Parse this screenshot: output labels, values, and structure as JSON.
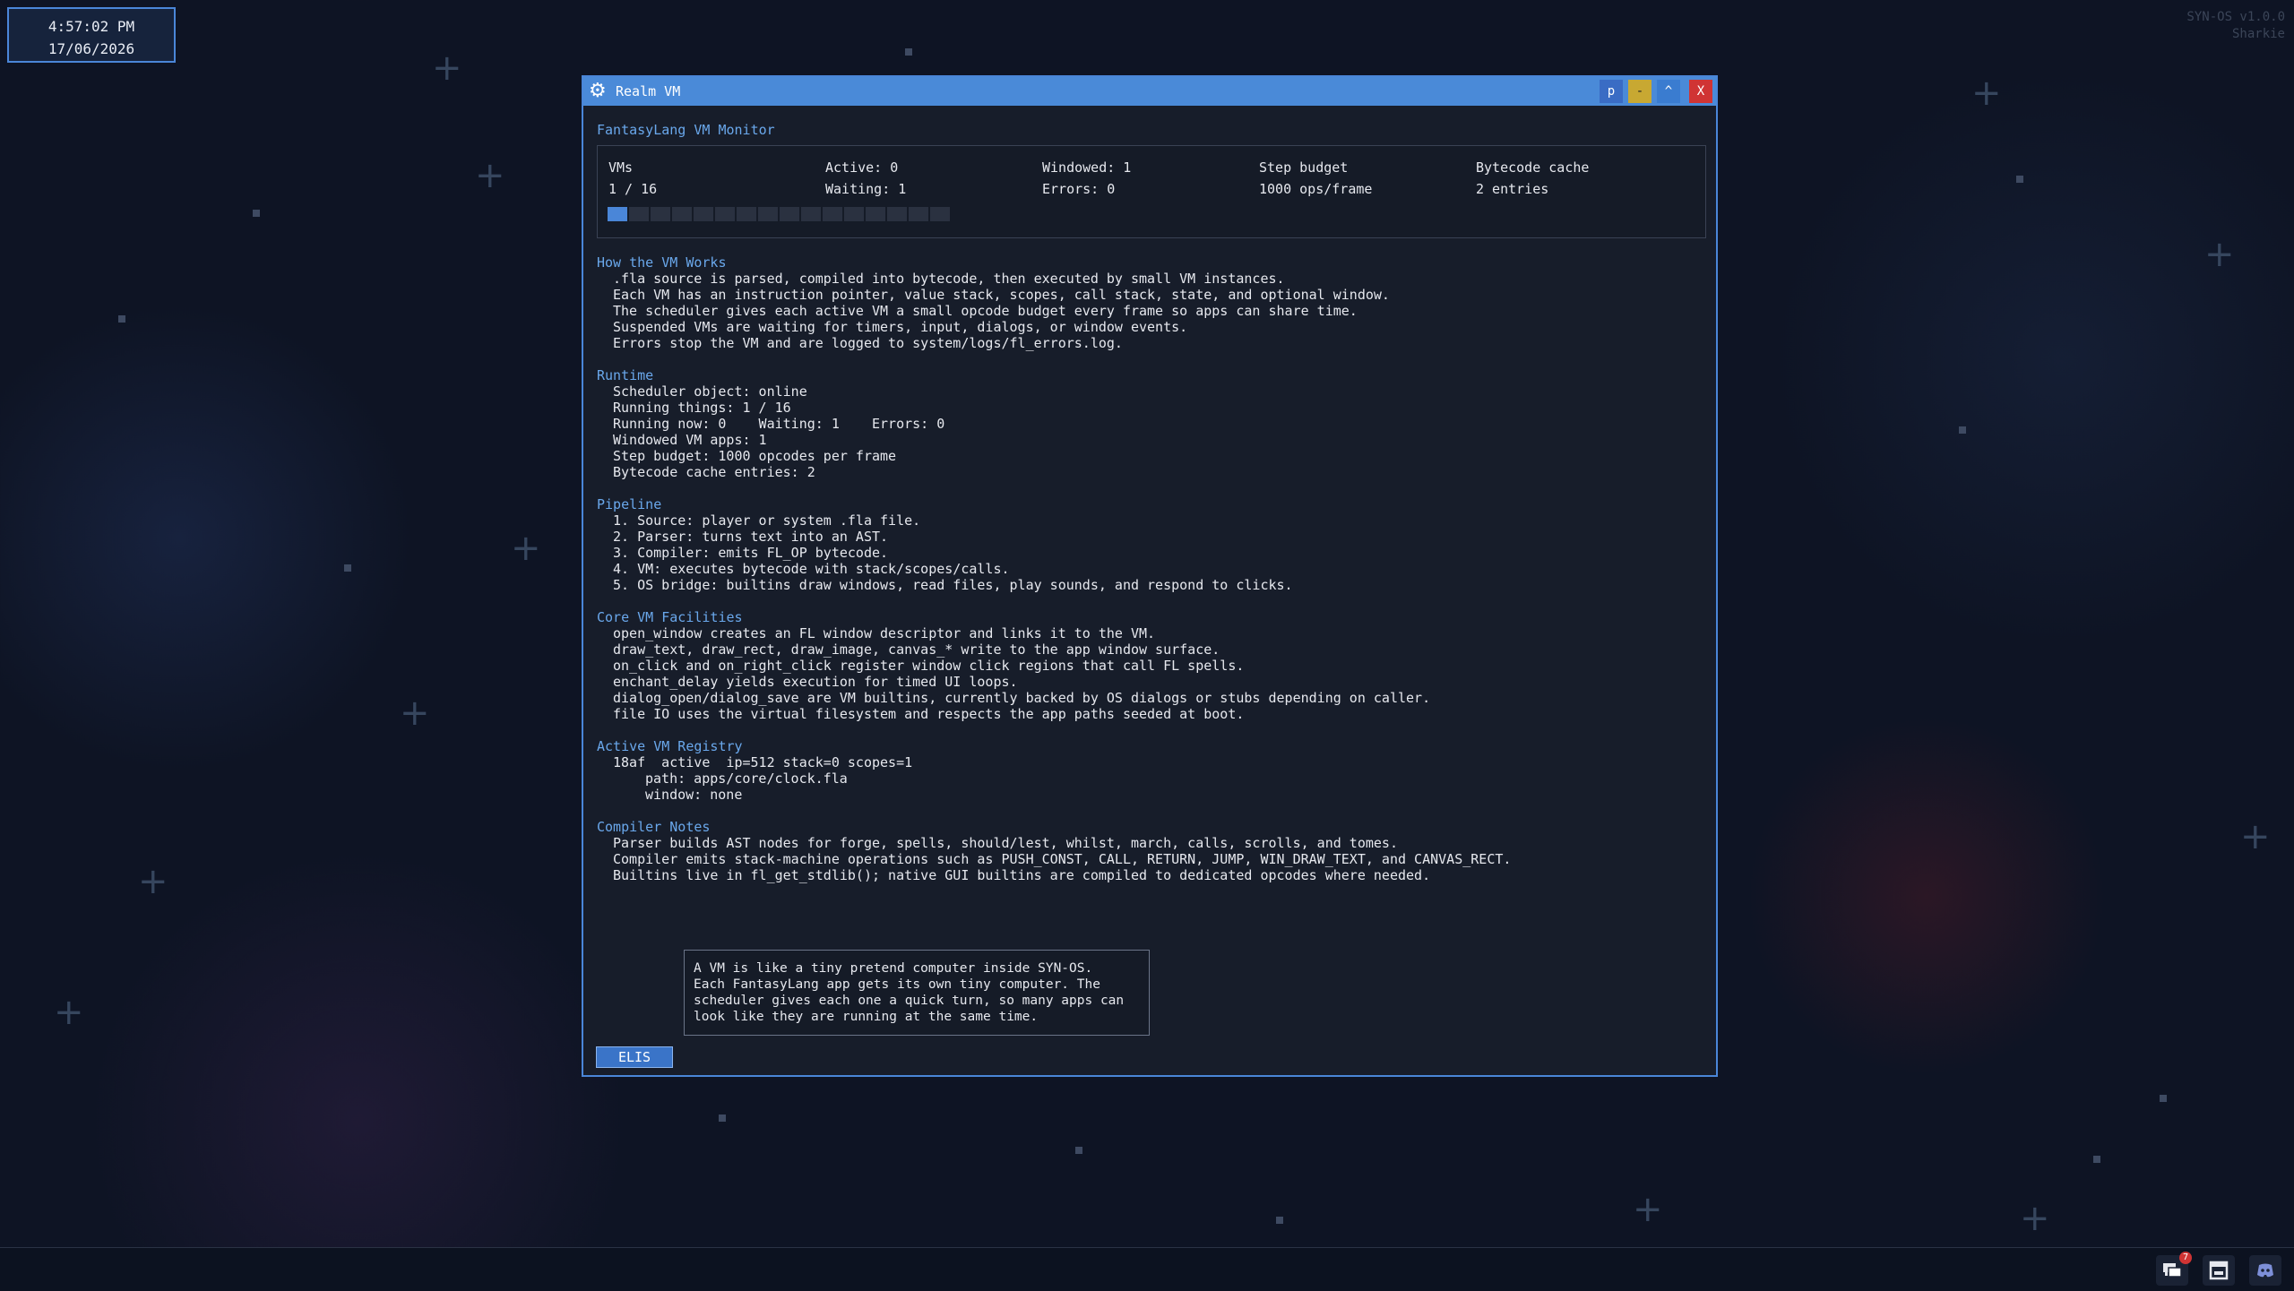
{
  "clock": {
    "time": "4:57:02 PM",
    "date": "17/06/2026"
  },
  "os": {
    "version": "SYN-OS v1.0.0",
    "user": "Sharkie"
  },
  "window": {
    "title": "Realm VM",
    "buttons": {
      "pin": "p",
      "minimize": "-",
      "maximize": "^",
      "close": "X"
    }
  },
  "monitor": {
    "title": "FantasyLang VM Monitor",
    "stats": {
      "vms_label": "VMs",
      "vms_value": "1 / 16",
      "active": "Active: 0",
      "waiting": "Waiting: 1",
      "windowed": "Windowed: 1",
      "errors": "Errors: 0",
      "budget_label": "Step budget",
      "budget_value": "1000 ops/frame",
      "cache_label": "Bytecode cache",
      "cache_value": "2 entries"
    },
    "slots_total": 16,
    "slots_used": 1
  },
  "sections": [
    {
      "title": "How the VM Works",
      "lines": [
        ".fla source is parsed, compiled into bytecode, then executed by small VM instances.",
        "Each VM has an instruction pointer, value stack, scopes, call stack, state, and optional window.",
        "The scheduler gives each active VM a small opcode budget every frame so apps can share time.",
        "Suspended VMs are waiting for timers, input, dialogs, or window events.",
        "Errors stop the VM and are logged to system/logs/fl_errors.log."
      ]
    },
    {
      "title": "Runtime",
      "lines": [
        "Scheduler object: online",
        "Running things: 1 / 16",
        "Running now: 0    Waiting: 1    Errors: 0",
        "Windowed VM apps: 1",
        "Step budget: 1000 opcodes per frame",
        "Bytecode cache entries: 2"
      ]
    },
    {
      "title": "Pipeline",
      "lines": [
        "1. Source: player or system .fla file.",
        "2. Parser: turns text into an AST.",
        "3. Compiler: emits FL_OP bytecode.",
        "4. VM: executes bytecode with stack/scopes/calls.",
        "5. OS bridge: builtins draw windows, read files, play sounds, and respond to clicks."
      ]
    },
    {
      "title": "Core VM Facilities",
      "lines": [
        "open_window creates an FL window descriptor and links it to the VM.",
        "draw_text, draw_rect, draw_image, canvas_* write to the app window surface.",
        "on_click and on_right_click register window click regions that call FL spells.",
        "enchant_delay yields execution for timed UI loops.",
        "dialog_open/dialog_save are VM builtins, currently backed by OS dialogs or stubs depending on caller.",
        "file IO uses the virtual filesystem and respects the app paths seeded at boot."
      ]
    },
    {
      "title": "Active VM Registry",
      "lines": [
        "18af  active  ip=512 stack=0 scopes=1"
      ],
      "sublines": [
        "path: apps/core/clock.fla",
        "window: none"
      ]
    },
    {
      "title": "Compiler Notes",
      "lines": [
        "Parser builds AST nodes for forge, spells, should/lest, whilst, march, calls, scrolls, and tomes.",
        "Compiler emits stack-machine operations such as PUSH_CONST, CALL, RETURN, JUMP, WIN_DRAW_TEXT, and CANVAS_RECT.",
        "Builtins live in fl_get_stdlib(); native GUI builtins are compiled to dedicated opcodes where needed."
      ]
    }
  ],
  "tip": {
    "lines": [
      "A VM is like a tiny pretend computer inside SYN-OS.",
      "Each FantasyLang app gets its own tiny computer. The",
      "scheduler gives each one a quick turn, so many apps can",
      "look like they are running at the same time."
    ]
  },
  "elis_button": "ELIS",
  "taskbar": {
    "notification_count": "7"
  },
  "colors": {
    "accent": "#4a8ad8",
    "section_title": "#6aa8ec",
    "close": "#d03434",
    "minimize": "#c8a832"
  }
}
